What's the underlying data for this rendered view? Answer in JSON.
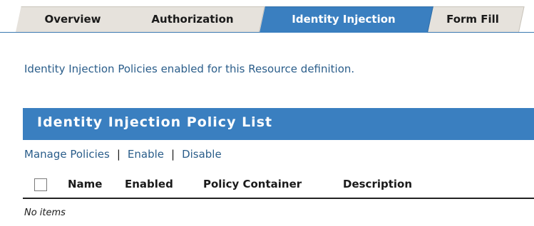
{
  "tabs": [
    {
      "label": "Overview",
      "active": false
    },
    {
      "label": "Authorization",
      "active": false
    },
    {
      "label": "Identity Injection",
      "active": true
    },
    {
      "label": "Form Fill",
      "active": false
    }
  ],
  "intro_text": "Identity Injection Policies enabled for this Resource definition.",
  "panel": {
    "title": "Identity Injection Policy List"
  },
  "actions": {
    "manage": "Manage Policies",
    "separator": "|",
    "enable": "Enable",
    "disable": "Disable"
  },
  "table": {
    "columns": [
      "Name",
      "Enabled",
      "Policy Container",
      "Description"
    ],
    "empty_text": "No items"
  },
  "colors": {
    "accent": "#3a7fc0",
    "link": "#2a5d8a",
    "tab_inactive": "#e6e2dc"
  }
}
